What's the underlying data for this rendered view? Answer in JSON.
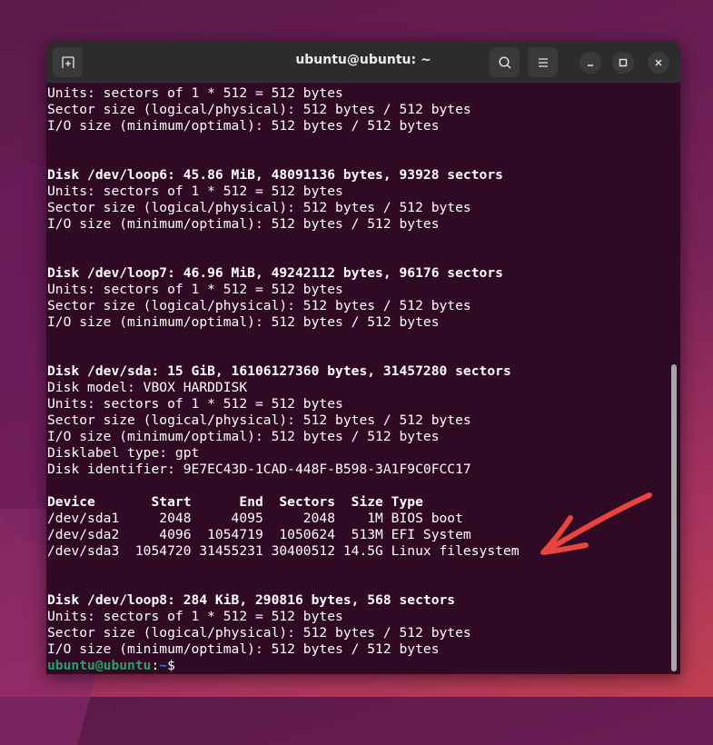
{
  "window": {
    "title": "ubuntu@ubuntu: ~",
    "buttons": {
      "new_tab": "new-tab-icon",
      "search": "search-icon",
      "menu": "hamburger-menu-icon",
      "minimize": "minimize-icon",
      "maximize": "maximize-icon",
      "close": "close-icon"
    }
  },
  "colors": {
    "terminal_bg": "#300a24",
    "titlebar_bg": "#2c2c2c",
    "prompt_user": "#26a269",
    "prompt_path": "#2a7bde",
    "annotation_arrow": "#e8453c"
  },
  "terminal": {
    "lines": [
      {
        "text": "Units: sectors of 1 * 512 = 512 bytes",
        "bold": false
      },
      {
        "text": "Sector size (logical/physical): 512 bytes / 512 bytes",
        "bold": false
      },
      {
        "text": "I/O size (minimum/optimal): 512 bytes / 512 bytes",
        "bold": false
      },
      {
        "text": "",
        "bold": false
      },
      {
        "text": "",
        "bold": false
      },
      {
        "text": "Disk /dev/loop6: 45.86 MiB, 48091136 bytes, 93928 sectors",
        "bold": true
      },
      {
        "text": "Units: sectors of 1 * 512 = 512 bytes",
        "bold": false
      },
      {
        "text": "Sector size (logical/physical): 512 bytes / 512 bytes",
        "bold": false
      },
      {
        "text": "I/O size (minimum/optimal): 512 bytes / 512 bytes",
        "bold": false
      },
      {
        "text": "",
        "bold": false
      },
      {
        "text": "",
        "bold": false
      },
      {
        "text": "Disk /dev/loop7: 46.96 MiB, 49242112 bytes, 96176 sectors",
        "bold": true
      },
      {
        "text": "Units: sectors of 1 * 512 = 512 bytes",
        "bold": false
      },
      {
        "text": "Sector size (logical/physical): 512 bytes / 512 bytes",
        "bold": false
      },
      {
        "text": "I/O size (minimum/optimal): 512 bytes / 512 bytes",
        "bold": false
      },
      {
        "text": "",
        "bold": false
      },
      {
        "text": "",
        "bold": false
      },
      {
        "text": "Disk /dev/sda: 15 GiB, 16106127360 bytes, 31457280 sectors",
        "bold": true
      },
      {
        "text": "Disk model: VBOX HARDDISK",
        "bold": false
      },
      {
        "text": "Units: sectors of 1 * 512 = 512 bytes",
        "bold": false
      },
      {
        "text": "Sector size (logical/physical): 512 bytes / 512 bytes",
        "bold": false
      },
      {
        "text": "I/O size (minimum/optimal): 512 bytes / 512 bytes",
        "bold": false
      },
      {
        "text": "Disklabel type: gpt",
        "bold": false
      },
      {
        "text": "Disk identifier: 9E7EC43D-1CAD-448F-B598-3A1F9C0FCC17",
        "bold": false
      },
      {
        "text": "",
        "bold": false
      },
      {
        "text": "Device       Start      End  Sectors  Size Type",
        "bold": true
      },
      {
        "text": "/dev/sda1     2048     4095     2048    1M BIOS boot",
        "bold": false
      },
      {
        "text": "/dev/sda2     4096  1054719  1050624  513M EFI System",
        "bold": false
      },
      {
        "text": "/dev/sda3  1054720 31455231 30400512 14.5G Linux filesystem",
        "bold": false
      },
      {
        "text": "",
        "bold": false
      },
      {
        "text": "",
        "bold": false
      },
      {
        "text": "Disk /dev/loop8: 284 KiB, 290816 bytes, 568 sectors",
        "bold": true
      },
      {
        "text": "Units: sectors of 1 * 512 = 512 bytes",
        "bold": false
      },
      {
        "text": "Sector size (logical/physical): 512 bytes / 512 bytes",
        "bold": false
      },
      {
        "text": "I/O size (minimum/optimal): 512 bytes / 512 bytes",
        "bold": false
      }
    ],
    "partition_table": {
      "headers": [
        "Device",
        "Start",
        "End",
        "Sectors",
        "Size",
        "Type"
      ],
      "rows": [
        [
          "/dev/sda1",
          "2048",
          "4095",
          "2048",
          "1M",
          "BIOS boot"
        ],
        [
          "/dev/sda2",
          "4096",
          "1054719",
          "1050624",
          "513M",
          "EFI System"
        ],
        [
          "/dev/sda3",
          "1054720",
          "31455231",
          "30400512",
          "14.5G",
          "Linux filesystem"
        ]
      ]
    },
    "prompt": {
      "user_host": "ubuntu@ubuntu",
      "separator": ":",
      "path": "~",
      "symbol": "$"
    }
  },
  "annotation": {
    "type": "arrow",
    "points_to": "/dev/sda3 Linux filesystem"
  }
}
